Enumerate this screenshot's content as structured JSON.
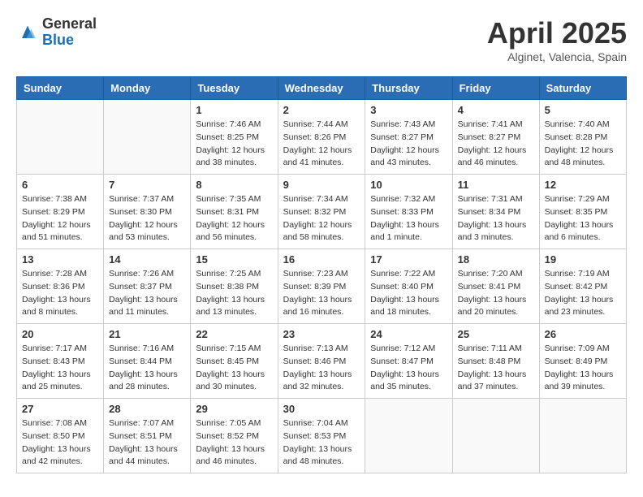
{
  "header": {
    "logo_general": "General",
    "logo_blue": "Blue",
    "month_title": "April 2025",
    "location": "Alginet, Valencia, Spain"
  },
  "weekdays": [
    "Sunday",
    "Monday",
    "Tuesday",
    "Wednesday",
    "Thursday",
    "Friday",
    "Saturday"
  ],
  "weeks": [
    [
      {
        "day": "",
        "info": ""
      },
      {
        "day": "",
        "info": ""
      },
      {
        "day": "1",
        "info": "Sunrise: 7:46 AM\nSunset: 8:25 PM\nDaylight: 12 hours\nand 38 minutes."
      },
      {
        "day": "2",
        "info": "Sunrise: 7:44 AM\nSunset: 8:26 PM\nDaylight: 12 hours\nand 41 minutes."
      },
      {
        "day": "3",
        "info": "Sunrise: 7:43 AM\nSunset: 8:27 PM\nDaylight: 12 hours\nand 43 minutes."
      },
      {
        "day": "4",
        "info": "Sunrise: 7:41 AM\nSunset: 8:27 PM\nDaylight: 12 hours\nand 46 minutes."
      },
      {
        "day": "5",
        "info": "Sunrise: 7:40 AM\nSunset: 8:28 PM\nDaylight: 12 hours\nand 48 minutes."
      }
    ],
    [
      {
        "day": "6",
        "info": "Sunrise: 7:38 AM\nSunset: 8:29 PM\nDaylight: 12 hours\nand 51 minutes."
      },
      {
        "day": "7",
        "info": "Sunrise: 7:37 AM\nSunset: 8:30 PM\nDaylight: 12 hours\nand 53 minutes."
      },
      {
        "day": "8",
        "info": "Sunrise: 7:35 AM\nSunset: 8:31 PM\nDaylight: 12 hours\nand 56 minutes."
      },
      {
        "day": "9",
        "info": "Sunrise: 7:34 AM\nSunset: 8:32 PM\nDaylight: 12 hours\nand 58 minutes."
      },
      {
        "day": "10",
        "info": "Sunrise: 7:32 AM\nSunset: 8:33 PM\nDaylight: 13 hours\nand 1 minute."
      },
      {
        "day": "11",
        "info": "Sunrise: 7:31 AM\nSunset: 8:34 PM\nDaylight: 13 hours\nand 3 minutes."
      },
      {
        "day": "12",
        "info": "Sunrise: 7:29 AM\nSunset: 8:35 PM\nDaylight: 13 hours\nand 6 minutes."
      }
    ],
    [
      {
        "day": "13",
        "info": "Sunrise: 7:28 AM\nSunset: 8:36 PM\nDaylight: 13 hours\nand 8 minutes."
      },
      {
        "day": "14",
        "info": "Sunrise: 7:26 AM\nSunset: 8:37 PM\nDaylight: 13 hours\nand 11 minutes."
      },
      {
        "day": "15",
        "info": "Sunrise: 7:25 AM\nSunset: 8:38 PM\nDaylight: 13 hours\nand 13 minutes."
      },
      {
        "day": "16",
        "info": "Sunrise: 7:23 AM\nSunset: 8:39 PM\nDaylight: 13 hours\nand 16 minutes."
      },
      {
        "day": "17",
        "info": "Sunrise: 7:22 AM\nSunset: 8:40 PM\nDaylight: 13 hours\nand 18 minutes."
      },
      {
        "day": "18",
        "info": "Sunrise: 7:20 AM\nSunset: 8:41 PM\nDaylight: 13 hours\nand 20 minutes."
      },
      {
        "day": "19",
        "info": "Sunrise: 7:19 AM\nSunset: 8:42 PM\nDaylight: 13 hours\nand 23 minutes."
      }
    ],
    [
      {
        "day": "20",
        "info": "Sunrise: 7:17 AM\nSunset: 8:43 PM\nDaylight: 13 hours\nand 25 minutes."
      },
      {
        "day": "21",
        "info": "Sunrise: 7:16 AM\nSunset: 8:44 PM\nDaylight: 13 hours\nand 28 minutes."
      },
      {
        "day": "22",
        "info": "Sunrise: 7:15 AM\nSunset: 8:45 PM\nDaylight: 13 hours\nand 30 minutes."
      },
      {
        "day": "23",
        "info": "Sunrise: 7:13 AM\nSunset: 8:46 PM\nDaylight: 13 hours\nand 32 minutes."
      },
      {
        "day": "24",
        "info": "Sunrise: 7:12 AM\nSunset: 8:47 PM\nDaylight: 13 hours\nand 35 minutes."
      },
      {
        "day": "25",
        "info": "Sunrise: 7:11 AM\nSunset: 8:48 PM\nDaylight: 13 hours\nand 37 minutes."
      },
      {
        "day": "26",
        "info": "Sunrise: 7:09 AM\nSunset: 8:49 PM\nDaylight: 13 hours\nand 39 minutes."
      }
    ],
    [
      {
        "day": "27",
        "info": "Sunrise: 7:08 AM\nSunset: 8:50 PM\nDaylight: 13 hours\nand 42 minutes."
      },
      {
        "day": "28",
        "info": "Sunrise: 7:07 AM\nSunset: 8:51 PM\nDaylight: 13 hours\nand 44 minutes."
      },
      {
        "day": "29",
        "info": "Sunrise: 7:05 AM\nSunset: 8:52 PM\nDaylight: 13 hours\nand 46 minutes."
      },
      {
        "day": "30",
        "info": "Sunrise: 7:04 AM\nSunset: 8:53 PM\nDaylight: 13 hours\nand 48 minutes."
      },
      {
        "day": "",
        "info": ""
      },
      {
        "day": "",
        "info": ""
      },
      {
        "day": "",
        "info": ""
      }
    ]
  ]
}
